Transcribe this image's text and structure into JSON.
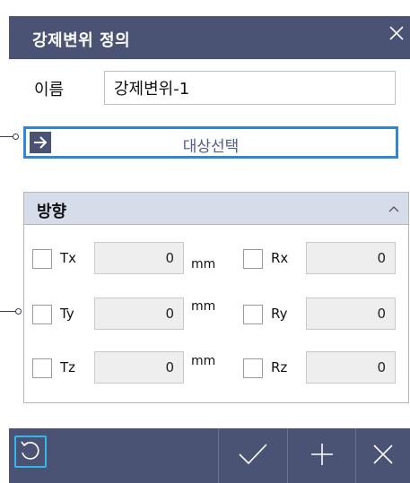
{
  "dialog": {
    "title": "강제변위 정의",
    "close_icon": "close-icon"
  },
  "name_row": {
    "label": "이름",
    "value": "강제변위-1"
  },
  "select_target": {
    "label": "대상선택",
    "icon": "arrow-right-icon"
  },
  "direction": {
    "title": "방향",
    "collapse_icon": "chevron-up-icon",
    "rows": [
      {
        "left_axis": "Tx",
        "left_value": "0",
        "unit": "mm",
        "right_axis": "Rx",
        "right_value": "0"
      },
      {
        "left_axis": "Ty",
        "left_value": "0",
        "unit": "mm",
        "right_axis": "Ry",
        "right_value": "0"
      },
      {
        "left_axis": "Tz",
        "left_value": "0",
        "unit": "mm",
        "right_axis": "Rz",
        "right_value": "0"
      }
    ]
  },
  "toolbar": {
    "buttons": [
      "reset-icon",
      "check-icon",
      "plus-icon",
      "close-icon"
    ]
  },
  "colors": {
    "title_bar": "#4b5374",
    "accent_blue": "#2f86d6",
    "group_header": "#d6dcea",
    "reset_outline": "#39b6e8"
  }
}
